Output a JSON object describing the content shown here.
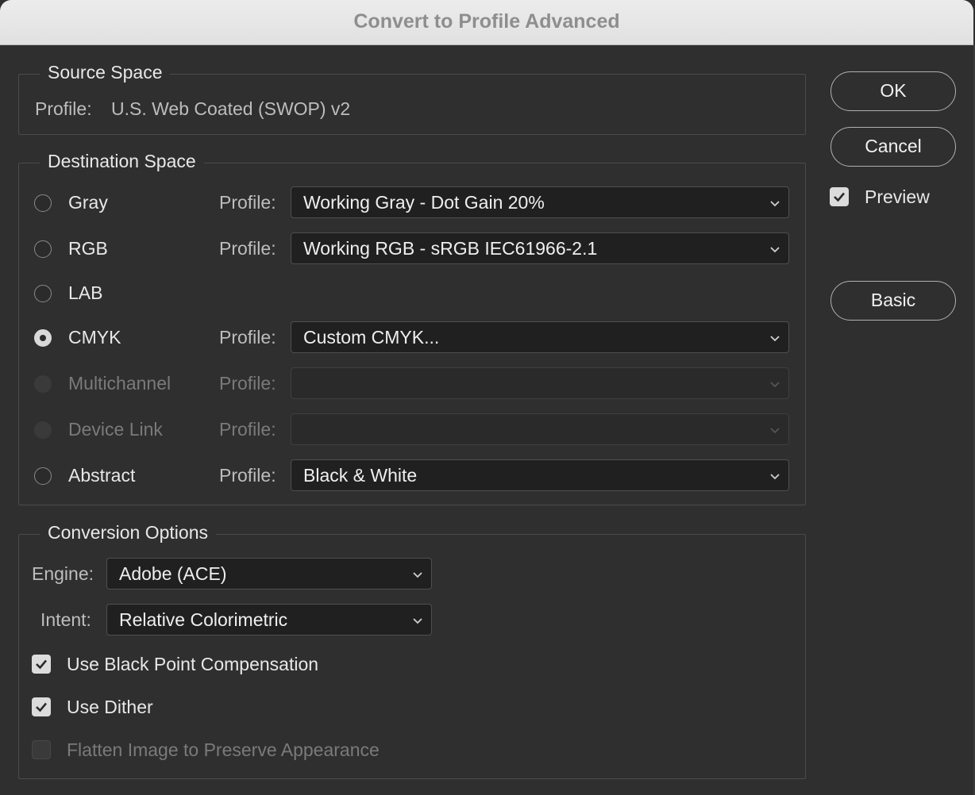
{
  "window": {
    "title": "Convert to Profile Advanced"
  },
  "source": {
    "legend": "Source Space",
    "profile_label": "Profile:",
    "profile_value": "U.S. Web Coated (SWOP) v2"
  },
  "destination": {
    "legend": "Destination Space",
    "profile_label": "Profile:",
    "gray": {
      "label": "Gray",
      "value": "Working Gray - Dot Gain 20%"
    },
    "rgb": {
      "label": "RGB",
      "value": "Working RGB - sRGB IEC61966-2.1"
    },
    "lab": {
      "label": "LAB"
    },
    "cmyk": {
      "label": "CMYK",
      "value": "Custom CMYK..."
    },
    "multichannel": {
      "label": "Multichannel",
      "value": ""
    },
    "device_link": {
      "label": "Device Link",
      "value": ""
    },
    "abstract": {
      "label": "Abstract",
      "value": "Black & White"
    },
    "selected": "CMYK"
  },
  "conversion": {
    "legend": "Conversion Options",
    "engine_label": "Engine:",
    "engine_value": "Adobe (ACE)",
    "intent_label": "Intent:",
    "intent_value": "Relative Colorimetric",
    "black_point": {
      "label": "Use Black Point Compensation",
      "checked": true
    },
    "dither": {
      "label": "Use Dither",
      "checked": true
    },
    "flatten": {
      "label": "Flatten Image to Preserve Appearance",
      "checked": false,
      "enabled": false
    }
  },
  "buttons": {
    "ok": "OK",
    "cancel": "Cancel",
    "basic": "Basic"
  },
  "preview": {
    "label": "Preview",
    "checked": true
  },
  "colors": {
    "background": "#2f2f2f",
    "titlebar": "#e6e6e6",
    "select_bg": "#202020"
  }
}
